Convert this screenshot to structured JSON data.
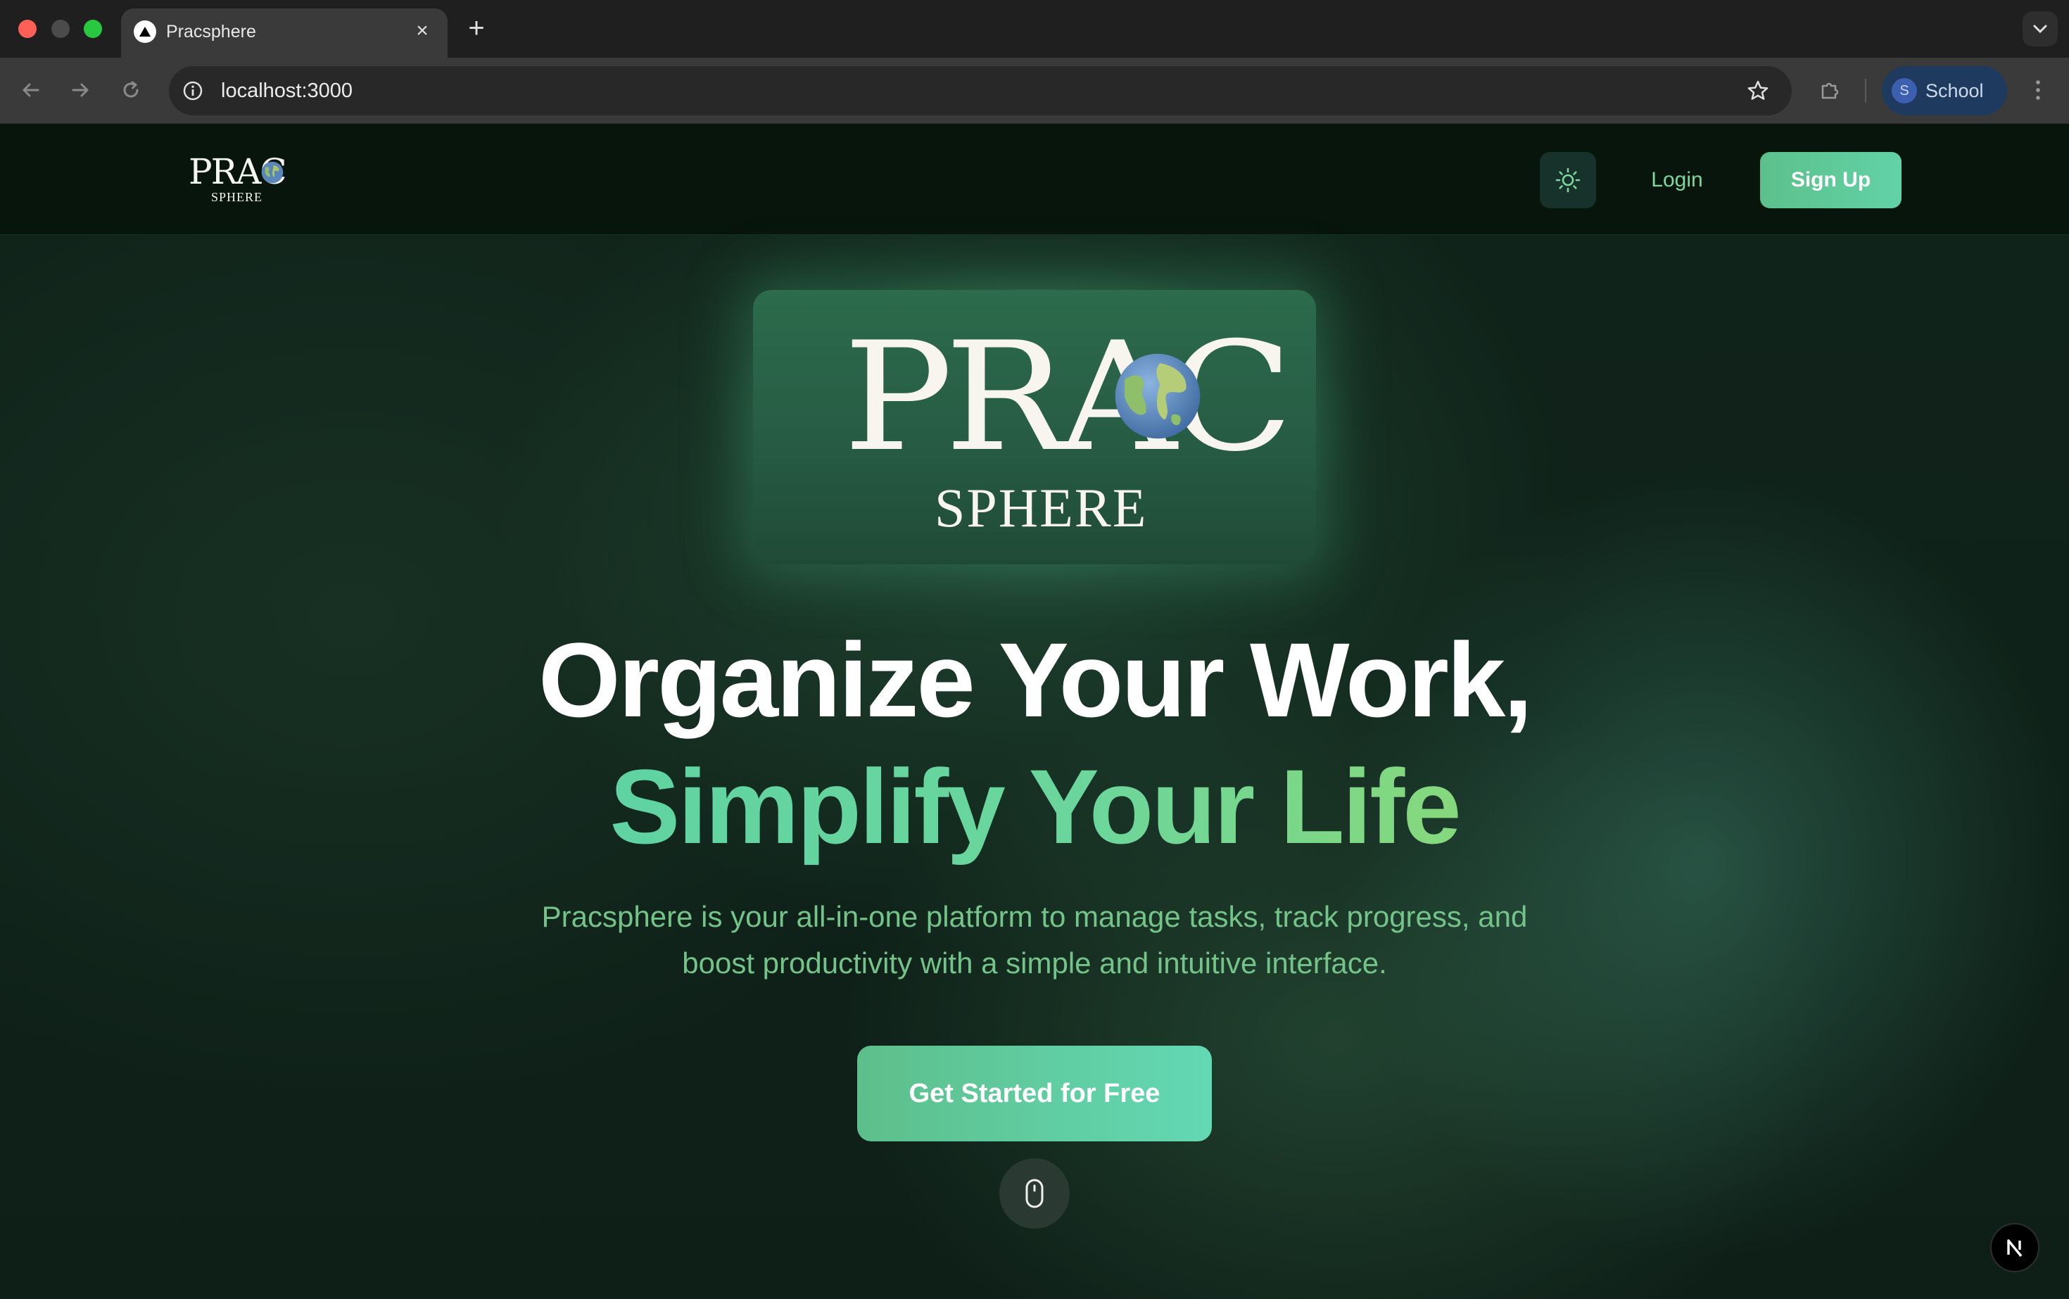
{
  "browser": {
    "tab_title": "Pracsphere",
    "tab_close": "×",
    "new_tab": "+",
    "url": "localhost:3000",
    "profile_initial": "S",
    "profile_name": "School"
  },
  "header": {
    "logo_top": "PRAC",
    "logo_bottom": "SPHERE",
    "theme_toggle_icon": "sun-icon",
    "login_label": "Login",
    "signup_label": "Sign Up"
  },
  "hero": {
    "logo_top": "PRAC",
    "logo_bottom": "SPHERE",
    "headline_line1": "Organize Your Work,",
    "headline_line2": "Simplify Your Life",
    "subtext": "Pracsphere is your all-in-one platform to manage tasks, track progress, and boost productivity with a simple and intuitive interface.",
    "cta_label": "Get Started for Free",
    "scroll_icon": "mouse-icon"
  },
  "badge": {
    "letter": "N"
  },
  "colors": {
    "accent": "#6fd49a",
    "button": "#5dbf8b",
    "login_text": "#7ed6a0",
    "subtext": "#74c48a"
  }
}
